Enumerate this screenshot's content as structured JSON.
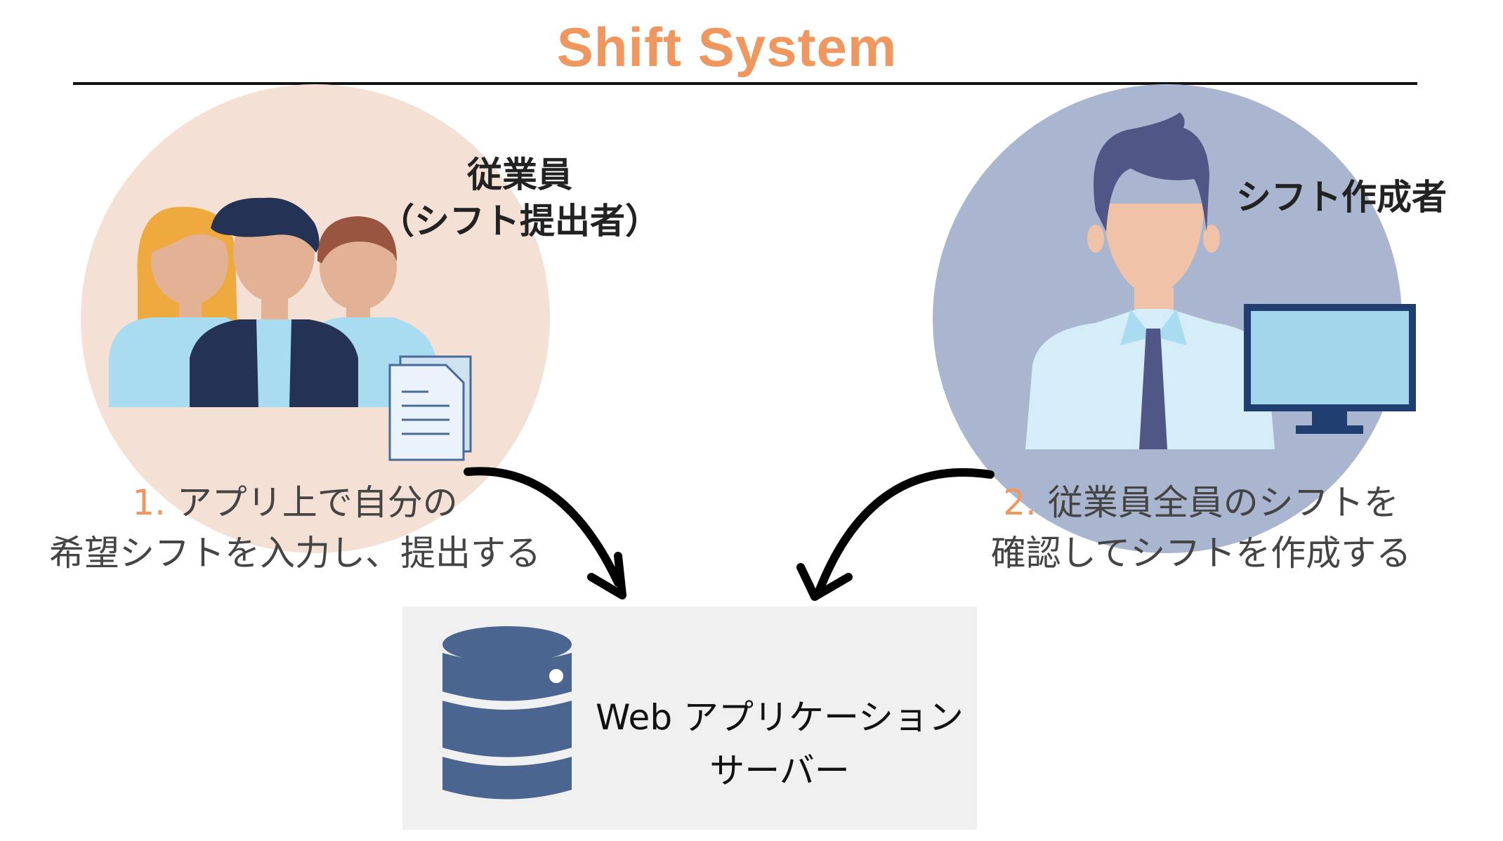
{
  "header": {
    "title": "Shift System"
  },
  "employee": {
    "role_line1": "従業員",
    "role_line2": "（シフト提出者）"
  },
  "creator": {
    "role": "シフト作成者"
  },
  "steps": [
    {
      "number": "1.",
      "line1": "アプリ上で自分の",
      "line2": "希望シフトを入力し、提出する"
    },
    {
      "number": "2.",
      "line1": "従業員全員のシフトを",
      "line2": "確認してシフトを作成する"
    }
  ],
  "server": {
    "line1": "Web アプリケーション",
    "line2": "サーバー"
  },
  "colors": {
    "accent": "#f0975f",
    "employee_circle": "#f5e0d5",
    "creator_circle": "#aab6cf",
    "server_box": "#f0f0f0"
  },
  "icons": [
    "employees-group-icon",
    "document-icon",
    "creator-person-icon",
    "monitor-icon",
    "database-icon",
    "arrow-icon"
  ]
}
